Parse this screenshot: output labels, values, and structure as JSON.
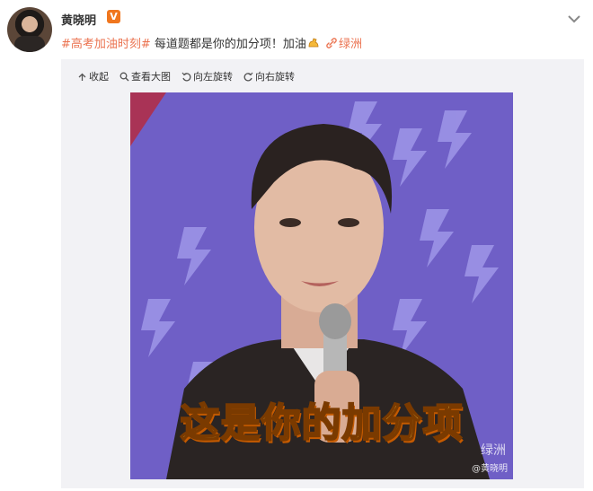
{
  "post": {
    "username": "黄晓明",
    "verified_badge": "V",
    "topic": "#高考加油时刻#",
    "body_text": " 每道题都是你的加分项！加油",
    "location": "绿洲",
    "icons": {
      "menu": "chevron-down-icon",
      "emoji": "flexed-arm-icon",
      "location": "link-icon"
    }
  },
  "media_toolbar": {
    "collapse": "收起",
    "view_large": "查看大图",
    "rotate_left": "向左旋转",
    "rotate_right": "向右旋转"
  },
  "image": {
    "caption": "这是你的加分项",
    "watermark_app": "绿洲",
    "watermark_user": "@黄晓明"
  },
  "colors": {
    "accent_link": "#eb7350",
    "verified": "#f0761e",
    "caption_fill": "#ffd54a",
    "photo_background": "#7561c8"
  }
}
